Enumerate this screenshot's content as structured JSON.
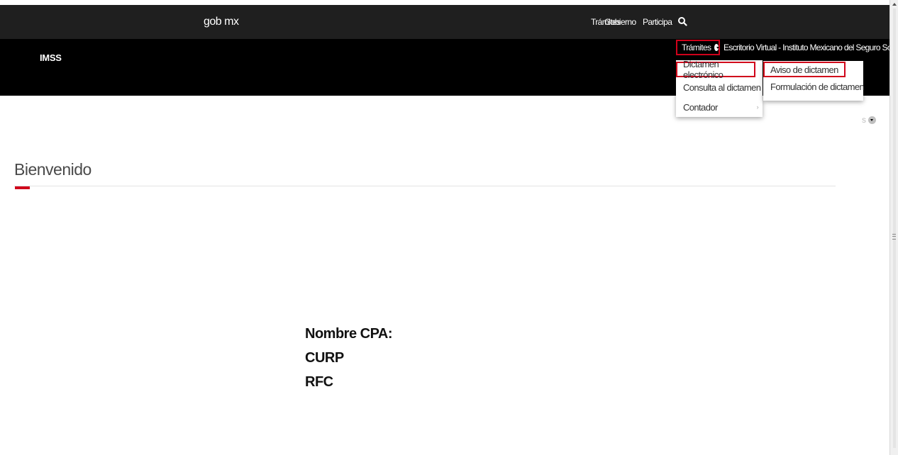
{
  "gob_bar": {
    "brand": "gob mx",
    "nav": [
      "Trámites",
      "Gobierno",
      "Participa"
    ],
    "search_icon": "search-icon"
  },
  "imss_bar": {
    "title": "IMSS",
    "tramites_label": "Trámites",
    "escritorio_link": "Escritorio Virtual - Instituto Mexicano del Seguro Social",
    "hidden_item_label": "s"
  },
  "dropdown": {
    "items": [
      {
        "label": "Dictamen electrónico",
        "has_submenu": true
      },
      {
        "label": "Consulta al dictamen",
        "has_submenu": true
      },
      {
        "label": "Contador",
        "has_submenu": true
      }
    ],
    "submenu_items": [
      {
        "label": "Aviso de dictamen"
      },
      {
        "label": "Formulación de dictamen"
      }
    ]
  },
  "main": {
    "welcome": "Bienvenido",
    "info_labels": [
      "Nombre CPA:",
      "CURP",
      "RFC"
    ]
  },
  "colors": {
    "accent": "#d0021b",
    "top_bar": "#1f1f1f",
    "imss_bar": "#000000"
  }
}
